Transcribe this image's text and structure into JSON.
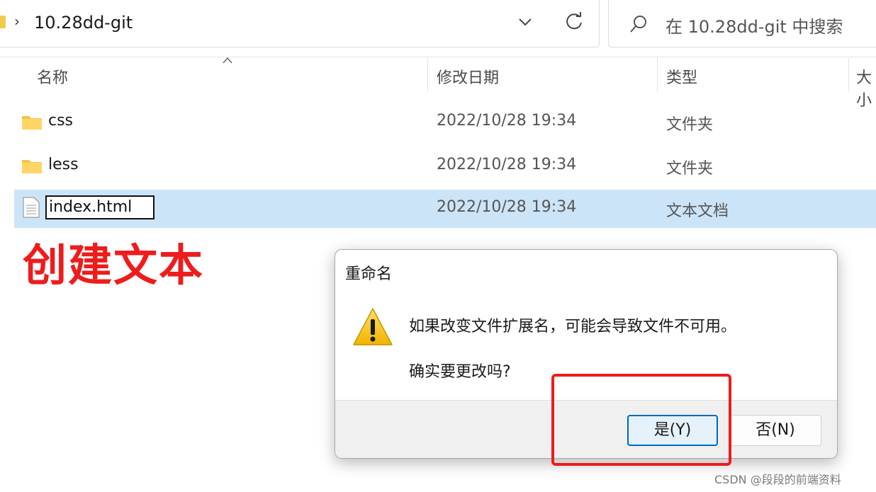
{
  "address_bar": {
    "path": "10.28dd-git",
    "separator": "›"
  },
  "search": {
    "placeholder": "在 10.28dd-git 中搜索"
  },
  "columns": {
    "name": "名称",
    "date": "修改日期",
    "type": "类型",
    "size": "大小"
  },
  "rows": [
    {
      "name": "css",
      "date": "2022/10/28 19:34",
      "type": "文件夹",
      "icon": "folder-icon"
    },
    {
      "name": "less",
      "date": "2022/10/28 19:34",
      "type": "文件夹",
      "icon": "folder-icon"
    },
    {
      "name": "index.html",
      "date": "2022/10/28 19:34",
      "type": "文本文档",
      "icon": "text-file-icon",
      "selected": true,
      "editing": true
    }
  ],
  "annotation": {
    "text": "创建文本",
    "color": "#ee1c1c"
  },
  "dialog": {
    "title": "重命名",
    "message": "如果改变文件扩展名，可能会导致文件不可用。",
    "question": "确实要更改吗?",
    "yes_label": "是(Y)",
    "no_label": "否(N)",
    "icon": "warning-icon"
  },
  "watermark": "CSDN @段段的前端资料",
  "colors": {
    "selection": "#cce4f7",
    "accent": "#0067c0",
    "highlight": "#ee1c1c"
  }
}
